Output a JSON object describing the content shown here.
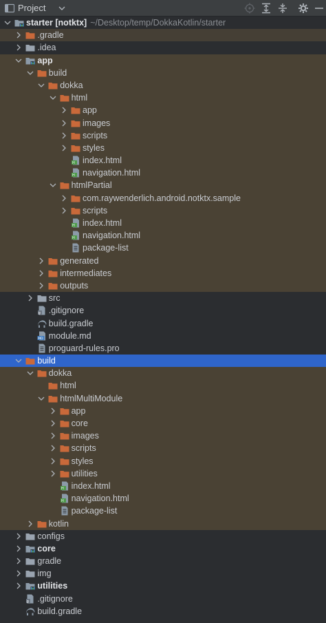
{
  "header": {
    "title": "Project",
    "tools": [
      "target-icon",
      "expand-all-icon",
      "collapse-all-icon",
      "gear-icon",
      "minimize-icon"
    ]
  },
  "colors": {
    "background": "#2b2d30",
    "selection": "#2f65ca",
    "folder": "#c9693a",
    "module_folder": "#8c9aa8",
    "html_file": "#4e9a4a",
    "text": "#c9ccd1"
  },
  "tree": [
    {
      "label": "starter [notktx]",
      "path": "~/Desktop/temp/DokkaKotlin/starter",
      "depth": 0,
      "arrow": "down",
      "icon": "module-folder-icon",
      "bold": true,
      "bg": ""
    },
    {
      "label": ".gradle",
      "depth": 1,
      "arrow": "right",
      "icon": "folder-orange-icon",
      "bold": false,
      "bg": "shaded"
    },
    {
      "label": ".idea",
      "depth": 1,
      "arrow": "right",
      "icon": "folder-grey-icon",
      "bold": false,
      "bg": ""
    },
    {
      "label": "app",
      "depth": 1,
      "arrow": "down",
      "icon": "module-folder-icon",
      "bold": true,
      "bg": "shaded-g"
    },
    {
      "label": "build",
      "depth": 2,
      "arrow": "down",
      "icon": "folder-orange-icon",
      "bold": false,
      "bg": "shaded-g"
    },
    {
      "label": "dokka",
      "depth": 3,
      "arrow": "down",
      "icon": "folder-orange-icon",
      "bold": false,
      "bg": "shaded-g"
    },
    {
      "label": "html",
      "depth": 4,
      "arrow": "down",
      "icon": "folder-orange-icon",
      "bold": false,
      "bg": "shaded-g"
    },
    {
      "label": "app",
      "depth": 5,
      "arrow": "right",
      "icon": "folder-orange-icon",
      "bold": false,
      "bg": "shaded-g"
    },
    {
      "label": "images",
      "depth": 5,
      "arrow": "right",
      "icon": "folder-orange-icon",
      "bold": false,
      "bg": "shaded-g"
    },
    {
      "label": "scripts",
      "depth": 5,
      "arrow": "right",
      "icon": "folder-orange-icon",
      "bold": false,
      "bg": "shaded-g"
    },
    {
      "label": "styles",
      "depth": 5,
      "arrow": "right",
      "icon": "folder-orange-icon",
      "bold": false,
      "bg": "shaded-g"
    },
    {
      "label": "index.html",
      "depth": 5,
      "arrow": "",
      "icon": "html-file-icon",
      "bold": false,
      "bg": "shaded-g"
    },
    {
      "label": "navigation.html",
      "depth": 5,
      "arrow": "",
      "icon": "html-file-icon",
      "bold": false,
      "bg": "shaded-g"
    },
    {
      "label": "htmlPartial",
      "depth": 4,
      "arrow": "down",
      "icon": "folder-orange-icon",
      "bold": false,
      "bg": "shaded-g"
    },
    {
      "label": "com.raywenderlich.android.notktx.sample",
      "depth": 5,
      "arrow": "right",
      "icon": "folder-orange-icon",
      "bold": false,
      "bg": "shaded-g"
    },
    {
      "label": "scripts",
      "depth": 5,
      "arrow": "right",
      "icon": "folder-orange-icon",
      "bold": false,
      "bg": "shaded-g"
    },
    {
      "label": "index.html",
      "depth": 5,
      "arrow": "",
      "icon": "html-file-icon",
      "bold": false,
      "bg": "shaded-g"
    },
    {
      "label": "navigation.html",
      "depth": 5,
      "arrow": "",
      "icon": "html-file-icon",
      "bold": false,
      "bg": "shaded-g"
    },
    {
      "label": "package-list",
      "depth": 5,
      "arrow": "",
      "icon": "text-file-icon",
      "bold": false,
      "bg": "shaded-g"
    },
    {
      "label": "generated",
      "depth": 3,
      "arrow": "right",
      "icon": "folder-orange-icon",
      "bold": false,
      "bg": "shaded-g"
    },
    {
      "label": "intermediates",
      "depth": 3,
      "arrow": "right",
      "icon": "folder-orange-icon",
      "bold": false,
      "bg": "shaded-g"
    },
    {
      "label": "outputs",
      "depth": 3,
      "arrow": "right",
      "icon": "folder-orange-icon",
      "bold": false,
      "bg": "shaded-g"
    },
    {
      "label": "src",
      "depth": 2,
      "arrow": "right",
      "icon": "folder-grey-icon",
      "bold": false,
      "bg": ""
    },
    {
      "label": ".gitignore",
      "depth": 2,
      "arrow": "",
      "icon": "gitignore-file-icon",
      "bold": false,
      "bg": ""
    },
    {
      "label": "build.gradle",
      "depth": 2,
      "arrow": "",
      "icon": "gradle-file-icon",
      "bold": false,
      "bg": ""
    },
    {
      "label": "module.md",
      "depth": 2,
      "arrow": "",
      "icon": "markdown-file-icon",
      "bold": false,
      "bg": ""
    },
    {
      "label": "proguard-rules.pro",
      "depth": 2,
      "arrow": "",
      "icon": "text-file-icon",
      "bold": false,
      "bg": ""
    },
    {
      "label": "build",
      "depth": 1,
      "arrow": "down",
      "icon": "folder-orange-icon",
      "bold": false,
      "bg": "selected"
    },
    {
      "label": "dokka",
      "depth": 2,
      "arrow": "down",
      "icon": "folder-orange-icon",
      "bold": false,
      "bg": "shaded-g"
    },
    {
      "label": "html",
      "depth": 3,
      "arrow": "",
      "icon": "folder-orange-icon",
      "bold": false,
      "bg": "shaded-g"
    },
    {
      "label": "htmlMultiModule",
      "depth": 3,
      "arrow": "down",
      "icon": "folder-orange-icon",
      "bold": false,
      "bg": "shaded-g"
    },
    {
      "label": "app",
      "depth": 4,
      "arrow": "right",
      "icon": "folder-orange-icon",
      "bold": false,
      "bg": "shaded-g"
    },
    {
      "label": "core",
      "depth": 4,
      "arrow": "right",
      "icon": "folder-orange-icon",
      "bold": false,
      "bg": "shaded-g"
    },
    {
      "label": "images",
      "depth": 4,
      "arrow": "right",
      "icon": "folder-orange-icon",
      "bold": false,
      "bg": "shaded-g"
    },
    {
      "label": "scripts",
      "depth": 4,
      "arrow": "right",
      "icon": "folder-orange-icon",
      "bold": false,
      "bg": "shaded-g"
    },
    {
      "label": "styles",
      "depth": 4,
      "arrow": "right",
      "icon": "folder-orange-icon",
      "bold": false,
      "bg": "shaded-g"
    },
    {
      "label": "utilities",
      "depth": 4,
      "arrow": "right",
      "icon": "folder-orange-icon",
      "bold": false,
      "bg": "shaded-g"
    },
    {
      "label": "index.html",
      "depth": 4,
      "arrow": "",
      "icon": "html-file-icon",
      "bold": false,
      "bg": "shaded-g"
    },
    {
      "label": "navigation.html",
      "depth": 4,
      "arrow": "",
      "icon": "html-file-icon",
      "bold": false,
      "bg": "shaded-g"
    },
    {
      "label": "package-list",
      "depth": 4,
      "arrow": "",
      "icon": "text-file-icon",
      "bold": false,
      "bg": "shaded-g"
    },
    {
      "label": "kotlin",
      "depth": 2,
      "arrow": "right",
      "icon": "folder-orange-icon",
      "bold": false,
      "bg": "shaded-g"
    },
    {
      "label": "configs",
      "depth": 1,
      "arrow": "right",
      "icon": "folder-grey-icon",
      "bold": false,
      "bg": ""
    },
    {
      "label": "core",
      "depth": 1,
      "arrow": "right",
      "icon": "module-folder-icon",
      "bold": true,
      "bg": ""
    },
    {
      "label": "gradle",
      "depth": 1,
      "arrow": "right",
      "icon": "folder-grey-icon",
      "bold": false,
      "bg": ""
    },
    {
      "label": "img",
      "depth": 1,
      "arrow": "right",
      "icon": "folder-grey-icon",
      "bold": false,
      "bg": ""
    },
    {
      "label": "utilities",
      "depth": 1,
      "arrow": "right",
      "icon": "module-folder-icon",
      "bold": true,
      "bg": ""
    },
    {
      "label": ".gitignore",
      "depth": 1,
      "arrow": "",
      "icon": "gitignore-file-icon",
      "bold": false,
      "bg": ""
    },
    {
      "label": "build.gradle",
      "depth": 1,
      "arrow": "",
      "icon": "gradle-file-icon",
      "bold": false,
      "bg": ""
    }
  ]
}
